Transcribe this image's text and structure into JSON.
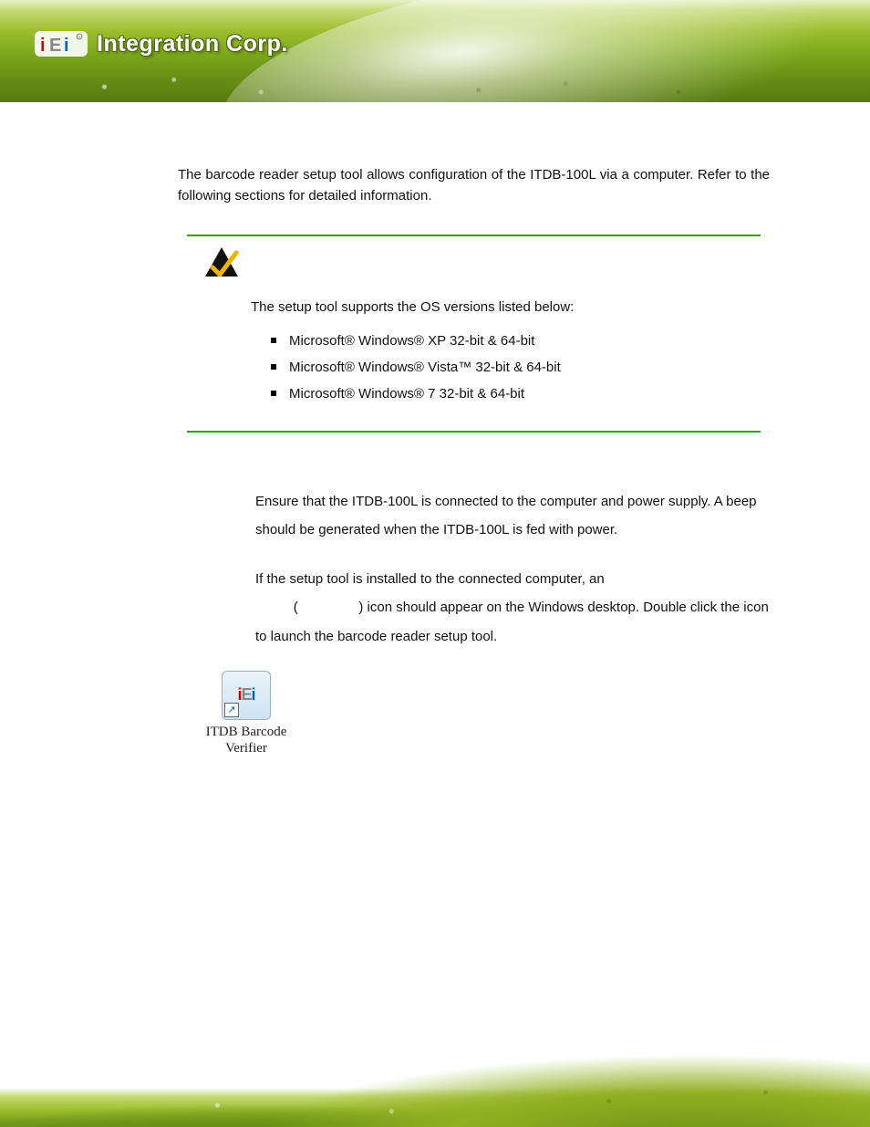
{
  "header": {
    "company_name": "Integration Corp.",
    "logo_alt": "iEi"
  },
  "body": {
    "intro": "The barcode reader setup tool allows configuration of the ITDB-100L via a computer. Refer to the following sections for detailed information.",
    "note": {
      "lead": "The setup tool supports the OS versions listed below:",
      "items": [
        "Microsoft® Windows® XP 32-bit & 64-bit",
        "Microsoft® Windows® Vista™ 32-bit & 64-bit",
        "Microsoft® Windows® 7 32-bit & 64-bit"
      ]
    },
    "steps": {
      "s1": "Ensure that the ITDB-100L is connected to the computer and power supply. A beep should be generated when the ITDB-100L is fed with power.",
      "s2_a": "If the setup tool is installed to the connected computer, an ",
      "s2_paren_open": "(",
      "s2_paren_close": ") icon should appear on the Windows desktop. Double click the icon to launch the barcode reader setup tool."
    },
    "desktop_icon": {
      "label_line1": "ITDB Barcode",
      "label_line2": "Verifier"
    }
  }
}
